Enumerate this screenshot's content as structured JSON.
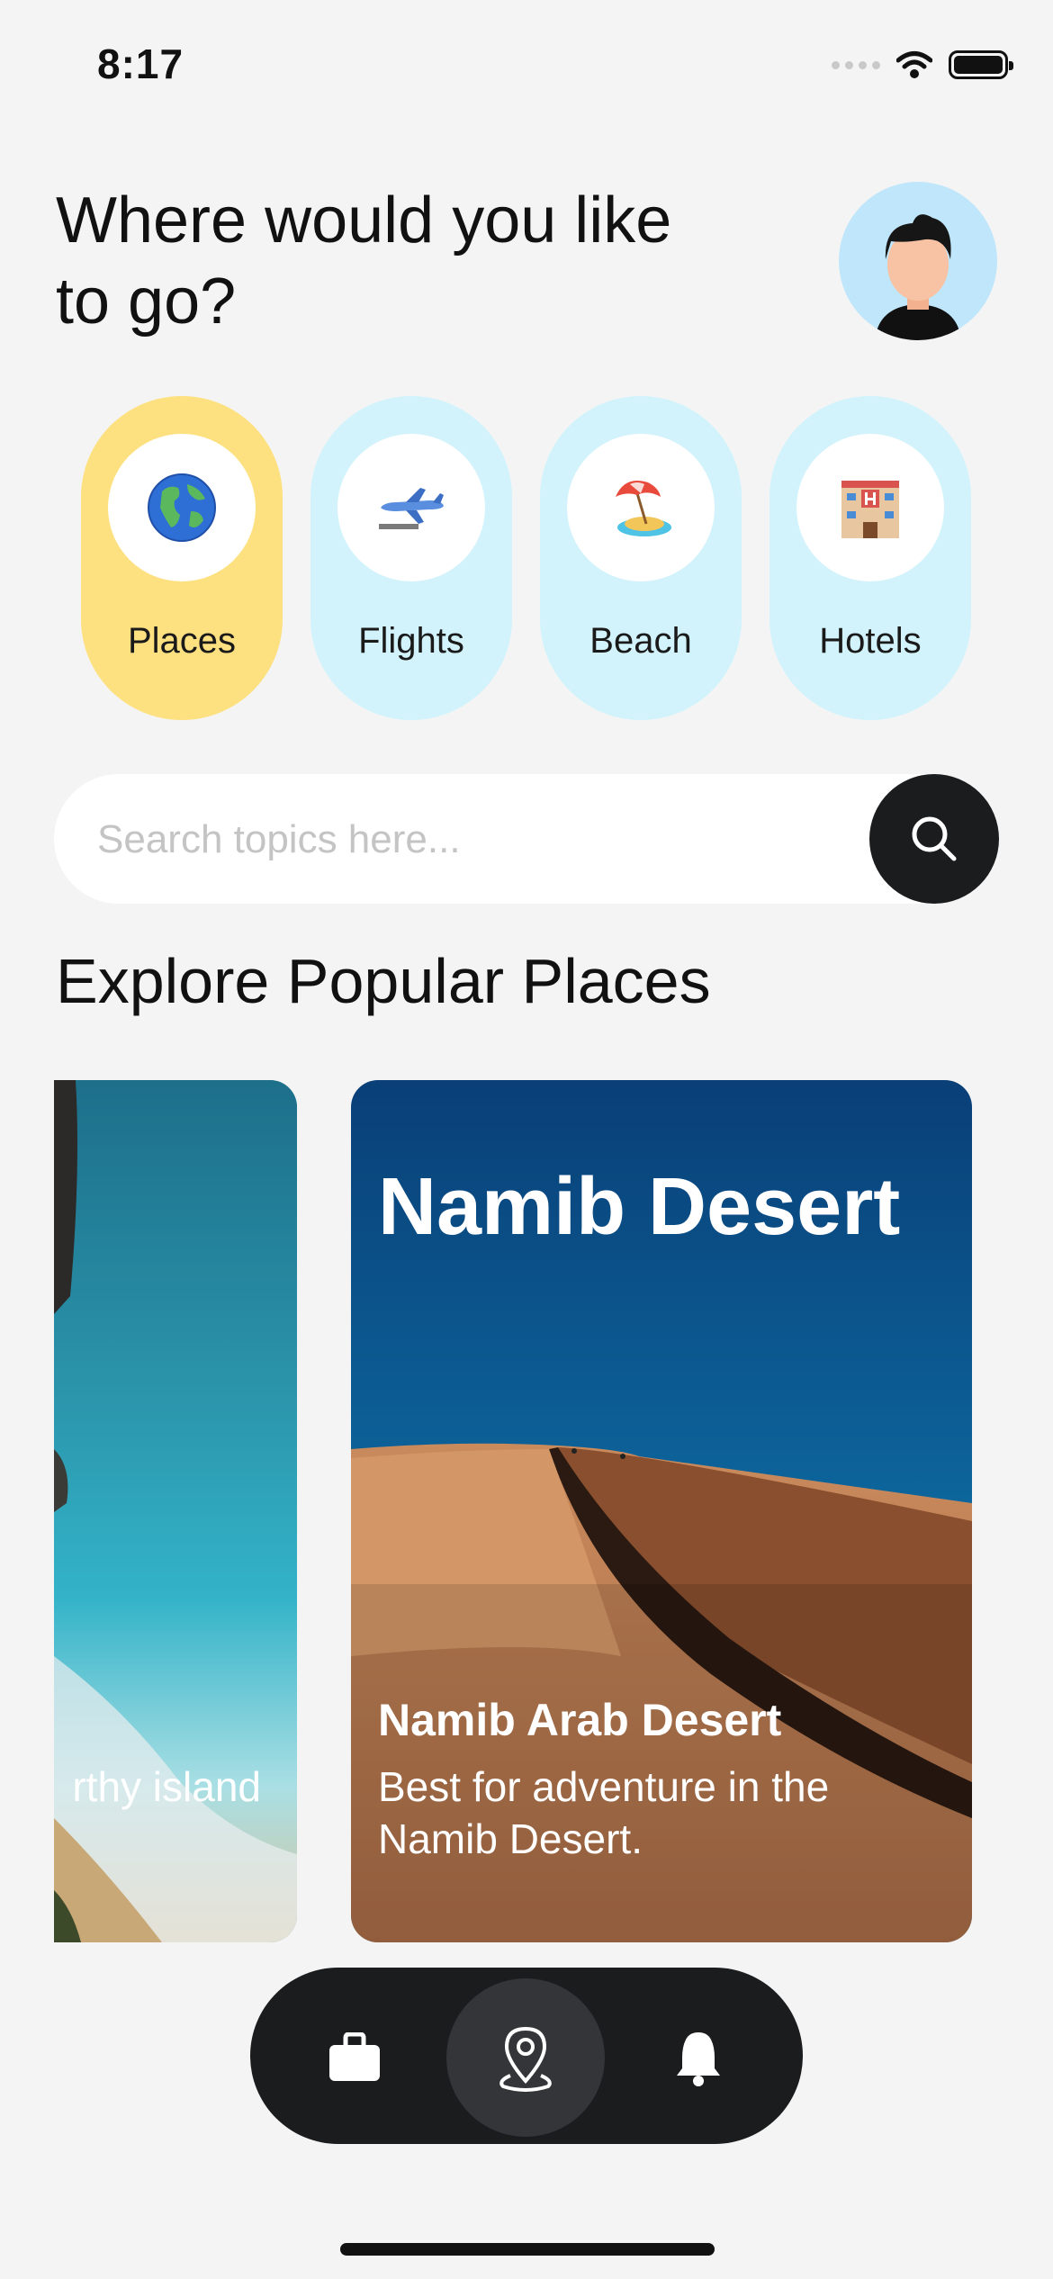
{
  "status_bar": {
    "time": "8:17"
  },
  "header": {
    "title": "Where would you like to go?"
  },
  "categories": [
    {
      "label": "Places",
      "icon": "globe-icon",
      "active": true
    },
    {
      "label": "Flights",
      "icon": "airplane-icon",
      "active": false
    },
    {
      "label": "Beach",
      "icon": "beach-umbrella-icon",
      "active": false
    },
    {
      "label": "Hotels",
      "icon": "hotel-icon",
      "active": false
    }
  ],
  "search": {
    "placeholder": "Search topics here..."
  },
  "section": {
    "title": "Explore Popular Places"
  },
  "cards": [
    {
      "description": "rthy island"
    },
    {
      "heading": "Namib Desert",
      "subtitle": "Namib Arab Desert",
      "description": "Best for adventure in the Namib Desert."
    }
  ],
  "bottom_nav": [
    {
      "icon": "briefcase-icon",
      "active": false
    },
    {
      "icon": "location-pin-icon",
      "active": true
    },
    {
      "icon": "bell-icon",
      "active": false
    }
  ],
  "colors": {
    "background": "#f4f4f4",
    "active_category": "#fde181",
    "inactive_category": "#d2f3fc",
    "dark": "#1b1c1e"
  }
}
